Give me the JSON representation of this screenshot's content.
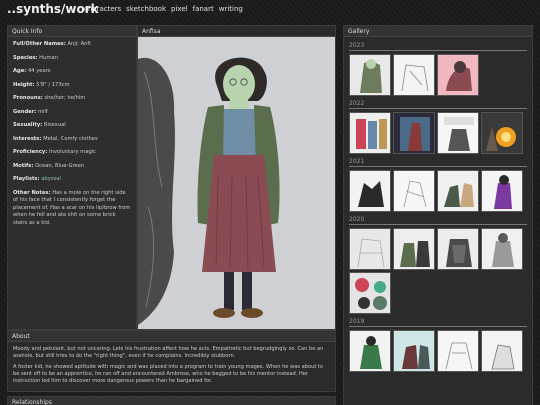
{
  "site": {
    "title": "..synths/work"
  },
  "nav": {
    "items": [
      "characters",
      "sketchbook",
      "pixel",
      "fanart",
      "writing"
    ]
  },
  "quick_info": {
    "header": "Quick Info",
    "rows": [
      {
        "label": "Full/Other Names:",
        "value": "Anji; Anfi"
      },
      {
        "label": "Species:",
        "value": "Human"
      },
      {
        "label": "Age:",
        "value": "44 years"
      },
      {
        "label": "Height:",
        "value": "5'8\" / 173cm"
      },
      {
        "label": "Pronouns:",
        "value": "she/her; he/him"
      },
      {
        "label": "Gender:",
        "value": "milf"
      },
      {
        "label": "Sexuality:",
        "value": "Bisexual"
      },
      {
        "label": "Interests:",
        "value": "Metal, Comfy clothes"
      },
      {
        "label": "Proficiency:",
        "value": "Involuntary magic"
      },
      {
        "label": "Motifs:",
        "value": "Ocean, Blue-Green"
      },
      {
        "label": "Playlists:",
        "value": "abyssal"
      },
      {
        "label": "Other Notes:",
        "value": "Has a mole on the right side of his face that I consistently forget the placement of. Has a scar on his lip/brow from when he fell and ate shit on some brick stairs as a kid."
      }
    ]
  },
  "portrait": {
    "header": "Anfisa"
  },
  "about": {
    "header": "About",
    "paragraphs": [
      "Moody and petulant, but not uncaring. Lets his frustration affect how he acts. Empathetic but begrudgingly so. Can be an asshole, but still tries to do the \"right thing\", even if he complains. Incredibly stubborn.",
      "A foster kid, he showed aptitude with magic and was placed into a program to train young mages. When he was about to be sent off to be an apprentice, he ran off and encountered Ambrose, who he begged to be his mentor instead. Her instruction led him to discover more dangerous powers than he bargained for."
    ]
  },
  "relationships": {
    "header": "Relationships"
  },
  "gallery": {
    "header": "Gallery",
    "years": [
      {
        "year": "2023",
        "thumbs": 3
      },
      {
        "year": "2022",
        "thumbs": 4
      },
      {
        "year": "2021",
        "thumbs": 4
      },
      {
        "year": "2020",
        "thumbs": 5
      },
      {
        "year": "2019",
        "thumbs": 4
      }
    ]
  }
}
